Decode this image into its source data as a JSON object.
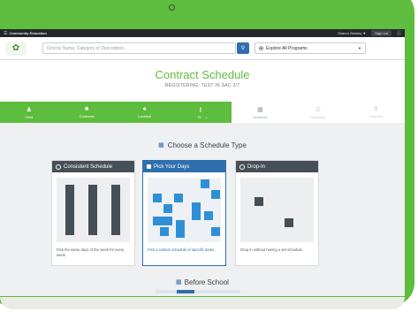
{
  "topbar": {
    "brand": "Community Education",
    "user": "Sharon Swamy ▼",
    "signout": "Sign out"
  },
  "search": {
    "placeholder": "Find by Name, Category or Description...",
    "explore_label": "Explore All Programs"
  },
  "header": {
    "title": "Contract Schedule",
    "subtitle": "REGISTERING: TEST IN SAC 2/7"
  },
  "steps": [
    {
      "label": "Child",
      "state": "done"
    },
    {
      "label": "Contracts",
      "state": "done"
    },
    {
      "label": "Location",
      "state": "done"
    },
    {
      "label": "Terms",
      "state": "done"
    },
    {
      "label": "Schedule",
      "state": "current"
    },
    {
      "label": "Summary",
      "state": "todo"
    },
    {
      "label": "Payment",
      "state": "todo"
    }
  ],
  "choose_label": "Choose a Schedule Type",
  "cards": [
    {
      "title": "Consistent Schedule",
      "desc": "Pick the same days of the week for every week.",
      "active": false
    },
    {
      "title": "Pick Your Days",
      "desc": "Pick a custom schedule of specific dates.",
      "active": true
    },
    {
      "title": "Drop-In",
      "desc": "Drop-in without having a set schedule.",
      "active": false
    }
  ],
  "before_label": "Before School",
  "colors": {
    "brand_green": "#5ebd3e",
    "accent_blue": "#2f6fae",
    "dark_header": "#474f56"
  }
}
